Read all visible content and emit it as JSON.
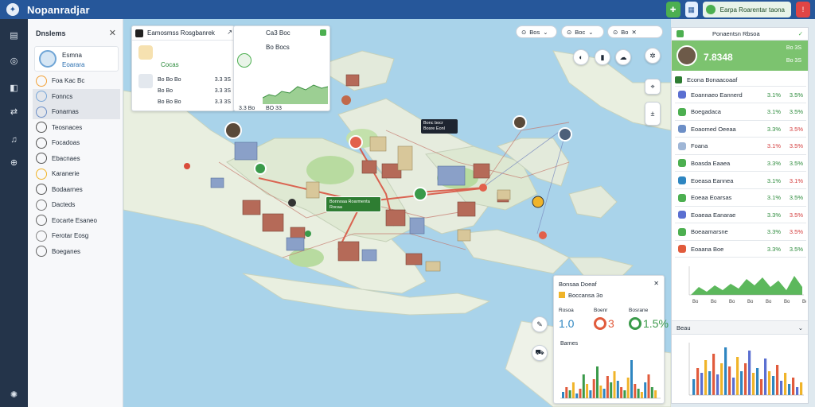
{
  "app": {
    "title": "Nopanradjar"
  },
  "topbar": {
    "status_label": "Earpa Roarentar taona"
  },
  "left_panel": {
    "title": "Dnslems",
    "profile": {
      "name": "Esmna",
      "subtitle": "Eoarara"
    },
    "items": [
      {
        "label": "Foa Kac Bc",
        "selected": false
      },
      {
        "label": "Fonncs",
        "selected": true
      },
      {
        "label": "Fonarnas",
        "selected": true
      },
      {
        "label": "Teosnaces",
        "selected": false
      },
      {
        "label": "Focadoas",
        "selected": false
      },
      {
        "label": "Ebacnaes",
        "selected": false
      },
      {
        "label": "Karanerie",
        "selected": false
      },
      {
        "label": "Bodaarnes",
        "selected": false
      },
      {
        "label": "Dacteds",
        "selected": false
      },
      {
        "label": "Eocarte Esaneo",
        "selected": false
      },
      {
        "label": "Ferotar Eosg",
        "selected": false
      },
      {
        "label": "Boeganes",
        "selected": false
      }
    ]
  },
  "map": {
    "card_left": {
      "title": "Eamosmss Rosgbanrek",
      "heading_value": "Cocas",
      "rows": [
        {
          "label": "Bo Bo Bo",
          "value": "3.3 3S"
        },
        {
          "label": "Bo Bo",
          "value": "3.3 3S"
        },
        {
          "label": "Bo Bo Bo",
          "value": "3.3 3S"
        }
      ]
    },
    "card_mid": {
      "title": "Ca3 Boc",
      "value_a": "Bo Bocs",
      "value_b": "3.3 Bo",
      "value_c": "BO 33"
    },
    "chips": [
      {
        "label": "Bos"
      },
      {
        "label": "Boc"
      },
      {
        "label": "Bo"
      }
    ],
    "tooltip_dark": "Bonc bocr Bosre Eonl",
    "tooltip_green": "Bonnoaa Roarmenta Rocaa",
    "stats_card": {
      "title": "Bonsaa Doeaf",
      "subtitle": "Boccansa 3o",
      "kpis": [
        {
          "label": "Rosoa",
          "value": "1.0"
        },
        {
          "label": "Boenr",
          "value": "3"
        },
        {
          "label": "Bosrane",
          "value": "1.5%"
        }
      ],
      "chart_label": "Barnes"
    }
  },
  "right_panel": {
    "header": "Ponaentsn Rbsoa",
    "hero_value": "7.8348",
    "hero_sub1": "Bo 3S",
    "hero_sub2": "Bo 3S",
    "section_title": "Econa Bonaacoaaf",
    "rows": [
      {
        "name": "Eoannaeo Eannerd",
        "v1": "3.1%",
        "v2": "3.5%",
        "neg1": false,
        "neg2": false,
        "color": "#5a6fd1"
      },
      {
        "name": "Boegadaca",
        "v1": "3.1%",
        "v2": "3.5%",
        "neg1": false,
        "neg2": false,
        "color": "#4caf50"
      },
      {
        "name": "Eoaomed Oeeaa",
        "v1": "3.3%",
        "v2": "3.5%",
        "neg1": false,
        "neg2": true,
        "color": "#6d8fc7"
      },
      {
        "name": "Foana",
        "v1": "3.1%",
        "v2": "3.5%",
        "neg1": true,
        "neg2": true,
        "color": "#9fb6d6"
      },
      {
        "name": "Boasda Eaaea",
        "v1": "3.3%",
        "v2": "3.5%",
        "neg1": false,
        "neg2": false,
        "color": "#4caf50"
      },
      {
        "name": "Eoeasa Eannea",
        "v1": "3.1%",
        "v2": "3.1%",
        "neg1": false,
        "neg2": true,
        "color": "#2e86c1"
      },
      {
        "name": "Eoeaa Eoarsas",
        "v1": "3.1%",
        "v2": "3.5%",
        "neg1": false,
        "neg2": false,
        "color": "#4caf50"
      },
      {
        "name": "Eoaeaa Eanarae",
        "v1": "3.3%",
        "v2": "3.5%",
        "neg1": false,
        "neg2": true,
        "color": "#5a6fd1"
      },
      {
        "name": "Boeaamarsne",
        "v1": "3.3%",
        "v2": "3.5%",
        "neg1": false,
        "neg2": true,
        "color": "#4caf50"
      },
      {
        "name": "Eoaana Boe",
        "v1": "3.3%",
        "v2": "3.5%",
        "neg1": false,
        "neg2": false,
        "color": "#e15b3c"
      }
    ],
    "bottom_section_title": "Beau",
    "area_ticks": [
      "Bo",
      "Bo",
      "Bo",
      "Bo",
      "Bo",
      "Bo",
      "Bo"
    ]
  }
}
